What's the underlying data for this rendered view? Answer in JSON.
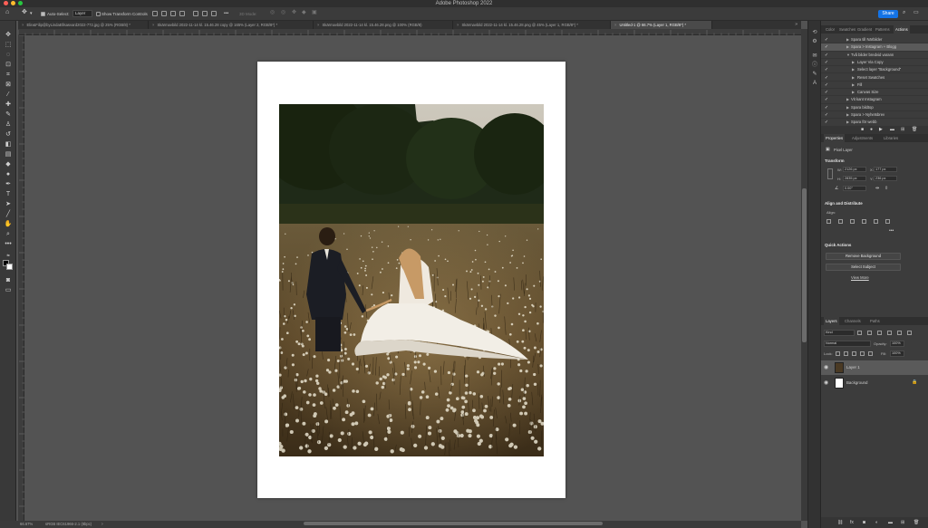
{
  "app": {
    "title": "Adobe Photoshop 2022"
  },
  "options_bar": {
    "auto_select_label": "Auto-Select:",
    "auto_select_value": "Layer",
    "show_transform_label": "Show Transform Controls",
    "mode_3d_label": "3D Mode:",
    "share_label": "Share"
  },
  "tabs": [
    {
      "label": "Elin&Filip@byLindaEllsasvard2022-772.jpg @ 25% (RGB/8) *",
      "active": false
    },
    {
      "label": "Skärmavbild 2022-11-14 kl. 15.46.28 copy @ 165% (Layer 2, RGB/8*) *",
      "active": false
    },
    {
      "label": "Skärmavbild 2022-11-14 kl. 15.46.28.png @ 100% (RGB/8)",
      "active": false
    },
    {
      "label": "Skärmavbild 2022-11-14 kl. 15.46.28.png @ 45% (Layer 1, RGB/8*) *",
      "active": false
    },
    {
      "label": "Untitled-1 @ 66.7% (Layer 1, RGB/8*) *",
      "active": true
    }
  ],
  "status_bar": {
    "zoom": "66.67%",
    "profile": "sRGB IEC61966-2.1 (8bpc)"
  },
  "actions_panel": {
    "tabs": [
      "Color",
      "Swatches",
      "Gradient",
      "Patterns",
      "Actions"
    ],
    "active_tab": "Actions",
    "rows": [
      {
        "label": "Spara till Närbilder",
        "indent": 1,
        "expanded": false,
        "selected": false
      },
      {
        "label": "Spara > Instagram + Blogg",
        "indent": 1,
        "expanded": false,
        "selected": true
      },
      {
        "label": "Två bilder bredvid varann",
        "indent": 1,
        "expanded": true,
        "selected": false
      },
      {
        "label": "Layer Via Copy",
        "indent": 2,
        "expanded": false,
        "selected": false
      },
      {
        "label": "Select layer “Background”",
        "indent": 2,
        "expanded": false,
        "selected": false
      },
      {
        "label": "Reset Swatches",
        "indent": 2,
        "expanded": false,
        "selected": false
      },
      {
        "label": "Fill",
        "indent": 2,
        "expanded": false,
        "selected": false
      },
      {
        "label": "Canvas Size",
        "indent": 2,
        "expanded": false,
        "selected": false
      },
      {
        "label": "Vit kant Instagram",
        "indent": 1,
        "expanded": false,
        "selected": false
      },
      {
        "label": "Spara bildtop",
        "indent": 1,
        "expanded": false,
        "selected": false
      },
      {
        "label": "Spara > Nyhetsbrev",
        "indent": 1,
        "expanded": false,
        "selected": false
      },
      {
        "label": "Spara för webb",
        "indent": 1,
        "expanded": false,
        "selected": false
      }
    ]
  },
  "properties_panel": {
    "tabs": [
      "Properties",
      "Adjustments",
      "Libraries"
    ],
    "layer_type": "Pixel Layer",
    "transform_heading": "Transform",
    "w_label": "W:",
    "w_value": "2126 px",
    "h_label": "H:",
    "h_value": "2835 px",
    "x_label": "X:",
    "x_value": "177 px",
    "y_label": "Y:",
    "y_value": "236 px",
    "angle_value": "0.00°",
    "align_heading": "Align and Distribute",
    "align_label": "Align:",
    "quick_actions_heading": "Quick Actions",
    "remove_bg_label": "Remove Background",
    "select_subject_label": "Select Subject",
    "view_more_label": "View More"
  },
  "layers_panel": {
    "tabs": [
      "Layers",
      "Channels",
      "Paths"
    ],
    "kind_label": "Kind",
    "blend_mode": "Normal",
    "opacity_label": "Opacity:",
    "opacity_value": "100%",
    "lock_label": "Lock:",
    "fill_label": "Fill:",
    "fill_value": "100%",
    "layers": [
      {
        "name": "Layer 1",
        "selected": true
      },
      {
        "name": "Background",
        "selected": false
      }
    ]
  },
  "colors": {
    "accent": "#1473e6",
    "panel": "#3c3c3c",
    "canvas": "#535353"
  }
}
